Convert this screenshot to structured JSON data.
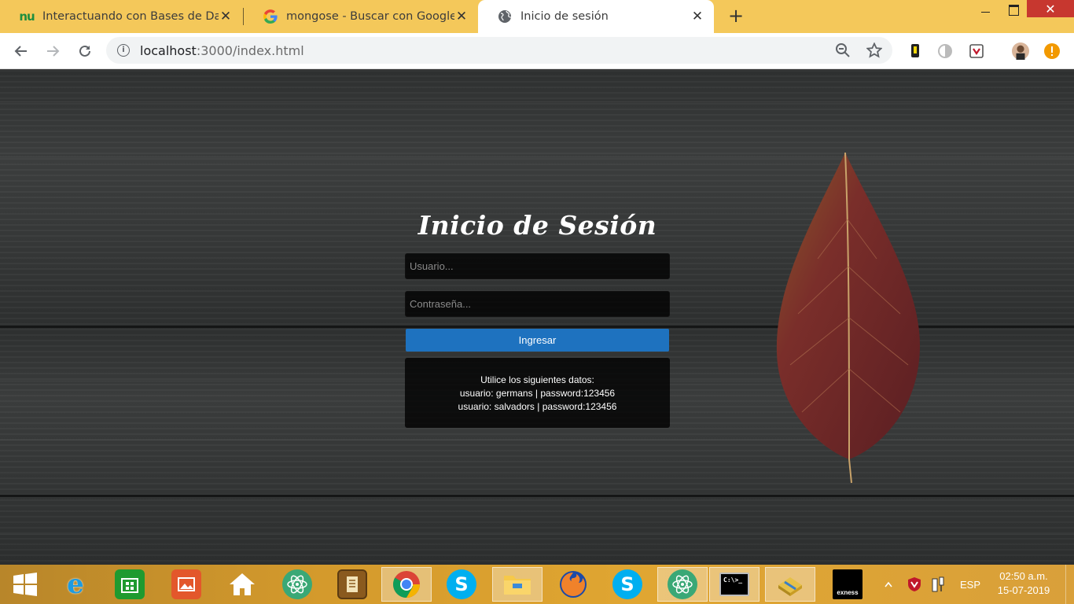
{
  "browser": {
    "tabs": [
      {
        "title": "Interactuando con Bases de Datos",
        "favicon": "nu-favicon",
        "favicon_text": "nu",
        "active": false
      },
      {
        "title": "mongose - Buscar con Google",
        "favicon": "google-favicon",
        "favicon_text": "G",
        "active": false
      },
      {
        "title": "Inicio de sesión",
        "favicon": "globe-favicon",
        "active": true
      }
    ],
    "new_tab_symbol": "+",
    "close_symbol": "✕",
    "window_close_symbol": "✕",
    "address": {
      "host": "localhost",
      "rest": ":3000/index.html"
    },
    "colors": {
      "tab_strip": "#f4c85a",
      "window_close": "#c7372f"
    }
  },
  "login": {
    "title": "Inicio de Sesión",
    "username_placeholder": "Usuario...",
    "password_placeholder": "Contraseña...",
    "submit_label": "Ingresar",
    "info_lines": [
      "Utilice los siguientes datos:",
      "usuario: germans | password:123456",
      "usuario: salvadors | password:123456"
    ],
    "colors": {
      "button": "#1e72bf"
    }
  },
  "taskbar": {
    "apps": [
      {
        "name": "start",
        "icon": "windows-logo-icon"
      },
      {
        "name": "internet-explorer",
        "icon": "ie-icon",
        "glyph": "e"
      },
      {
        "name": "store",
        "icon": "store-icon"
      },
      {
        "name": "photos",
        "icon": "photos-icon"
      },
      {
        "name": "home",
        "icon": "home-icon"
      },
      {
        "name": "atom-1",
        "icon": "atom-icon"
      },
      {
        "name": "notes",
        "icon": "notes-icon"
      },
      {
        "name": "chrome",
        "icon": "chrome-icon",
        "active": true
      },
      {
        "name": "skype-1",
        "icon": "skype-icon",
        "glyph": "S"
      },
      {
        "name": "file-explorer",
        "icon": "folder-icon"
      },
      {
        "name": "firefox",
        "icon": "firefox-icon"
      },
      {
        "name": "skype-2",
        "icon": "skype-icon",
        "glyph": "S"
      },
      {
        "name": "atom-2",
        "icon": "atom-icon"
      },
      {
        "name": "cmd",
        "icon": "terminal-icon",
        "glyph": "C:\\>_"
      },
      {
        "name": "archive",
        "icon": "archive-icon"
      },
      {
        "name": "exness",
        "icon": "exness-icon",
        "glyph": "exness"
      }
    ],
    "tray": {
      "language": "ESP",
      "time": "02:50 a.m.",
      "date": "15-07-2019"
    }
  }
}
